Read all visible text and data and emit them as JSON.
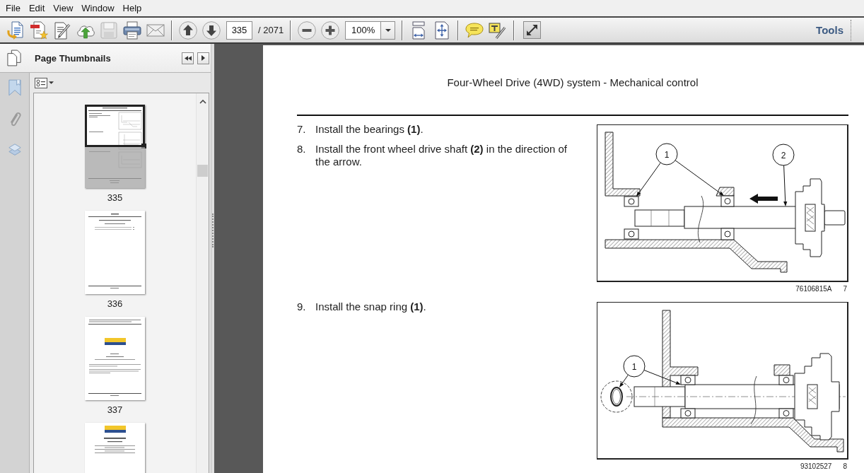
{
  "menu": [
    "File",
    "Edit",
    "View",
    "Window",
    "Help"
  ],
  "toolbar": {
    "save_button": {
      "disabled": true
    },
    "page_field": {
      "value": "335"
    },
    "page_count": "/ 2071",
    "zoom_field": {
      "value": "100%"
    },
    "tools_label": "Tools"
  },
  "sidebar": {
    "title": "Page Thumbnails",
    "thumbnails": [
      {
        "kind": "figures",
        "label": "335",
        "selected": true
      },
      {
        "kind": "contents",
        "label": "336",
        "selected": false
      },
      {
        "kind": "cover",
        "label": "337",
        "selected": false
      },
      {
        "kind": "title",
        "selected": false
      }
    ]
  },
  "document": {
    "header": "Four-Wheel Drive (4WD) system - Mechanical control",
    "sections": [
      {
        "steps": [
          {
            "number": "7.",
            "text": "Install the bearings **(1)**."
          },
          {
            "number": "8.",
            "text": "Install the front wheel drive shaft **(2)** in the direction of the arrow."
          }
        ],
        "figure": {
          "kind": "bearings",
          "callouts": [
            "1",
            "2"
          ],
          "code": "76106815A",
          "number": "7"
        }
      },
      {
        "steps": [
          {
            "number": "9.",
            "text": "Install the snap ring **(1)**."
          }
        ],
        "figure": {
          "kind": "snap_ring",
          "callouts": [
            "1"
          ],
          "code": "93102527",
          "number": "8"
        }
      }
    ]
  }
}
